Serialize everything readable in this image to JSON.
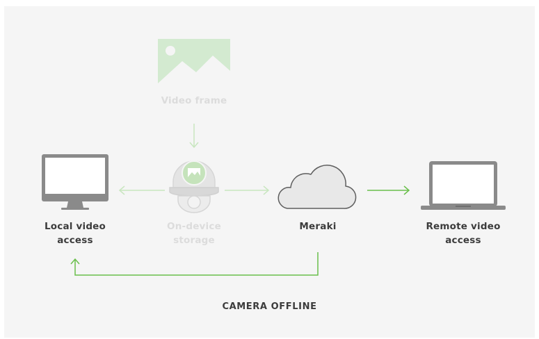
{
  "nodes": {
    "video_frame": "Video frame",
    "local_video": "Local video access",
    "on_device": "On-device storage",
    "meraki": "Meraki",
    "remote_video": "Remote video access"
  },
  "caption": "CAMERA OFFLINE",
  "colors": {
    "accent_green": "#6abf4b",
    "faded_green": "#c5e3bb",
    "faded_gray": "#dcdcdc",
    "icon_gray": "#8a8a8a",
    "text": "#3c3c3c",
    "background": "#f5f5f5"
  },
  "icons": [
    "image-icon",
    "monitor-icon",
    "camera-icon",
    "cloud-icon",
    "laptop-icon"
  ]
}
